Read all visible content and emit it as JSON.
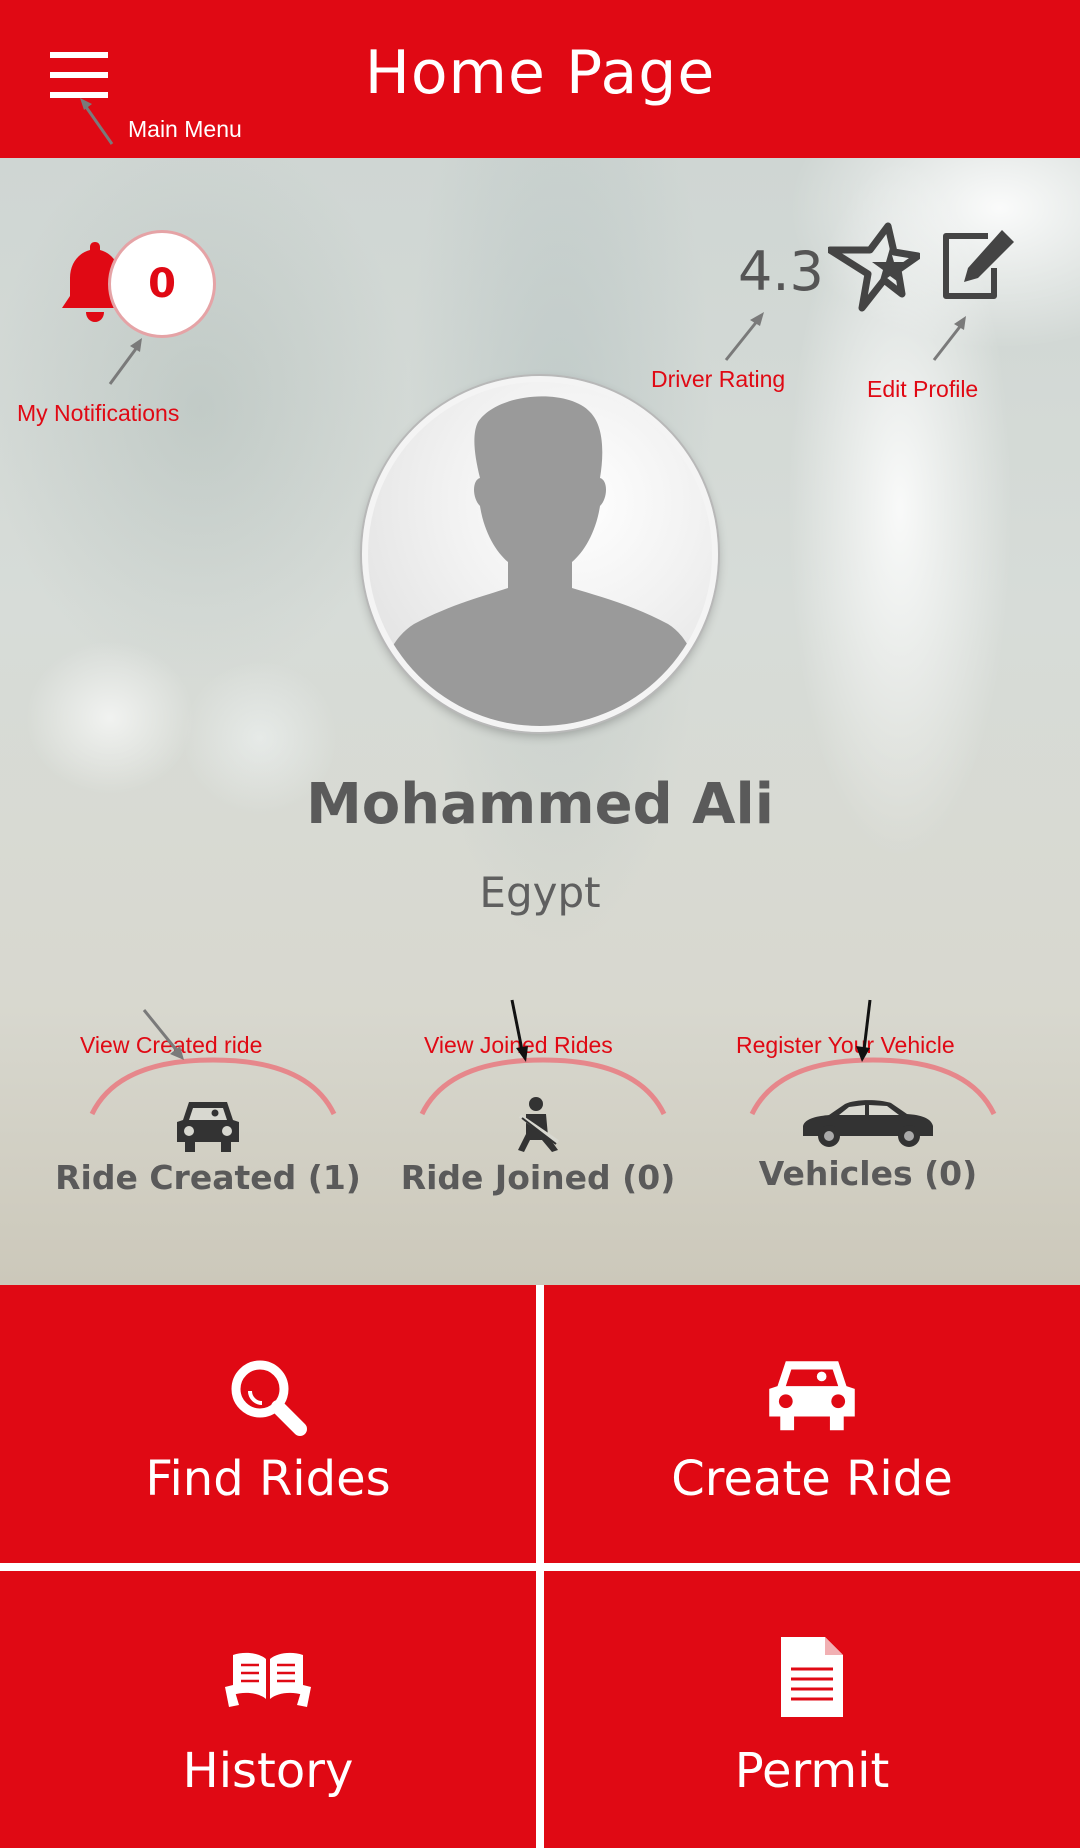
{
  "header": {
    "title": "Home Page",
    "menu_icon": "hamburger-menu-icon",
    "menu_annotation": "Main Menu"
  },
  "notifications": {
    "count": "0",
    "icon": "bell-icon",
    "annotation": "My Notifications"
  },
  "rating": {
    "value": "4.3",
    "icon": "star-icon",
    "annotation": "Driver Rating"
  },
  "edit_profile": {
    "icon": "edit-icon",
    "annotation": "Edit Profile"
  },
  "profile": {
    "name": "Mohammed Ali",
    "country": "Egypt",
    "avatar_icon": "user-silhouette-icon"
  },
  "stats": [
    {
      "label": "Ride Created (1)",
      "annotation": "View Created ride",
      "icon": "car-front-icon"
    },
    {
      "label": "Ride Joined (0)",
      "annotation": "View Joined Rides",
      "icon": "seatbelt-icon"
    },
    {
      "label": "Vehicles (0)",
      "annotation": "Register Your Vehicle",
      "icon": "car-side-icon"
    }
  ],
  "tiles": [
    {
      "label": "Find Rides",
      "icon": "search-icon"
    },
    {
      "label": "Create Ride",
      "icon": "car-front-icon"
    },
    {
      "label": "History",
      "icon": "open-book-icon"
    },
    {
      "label": "Permit",
      "icon": "document-icon"
    }
  ],
  "colors": {
    "brand_red": "#e00914",
    "text_gray": "#5a5a5a",
    "annotation_red": "#e00914",
    "white": "#ffffff"
  }
}
